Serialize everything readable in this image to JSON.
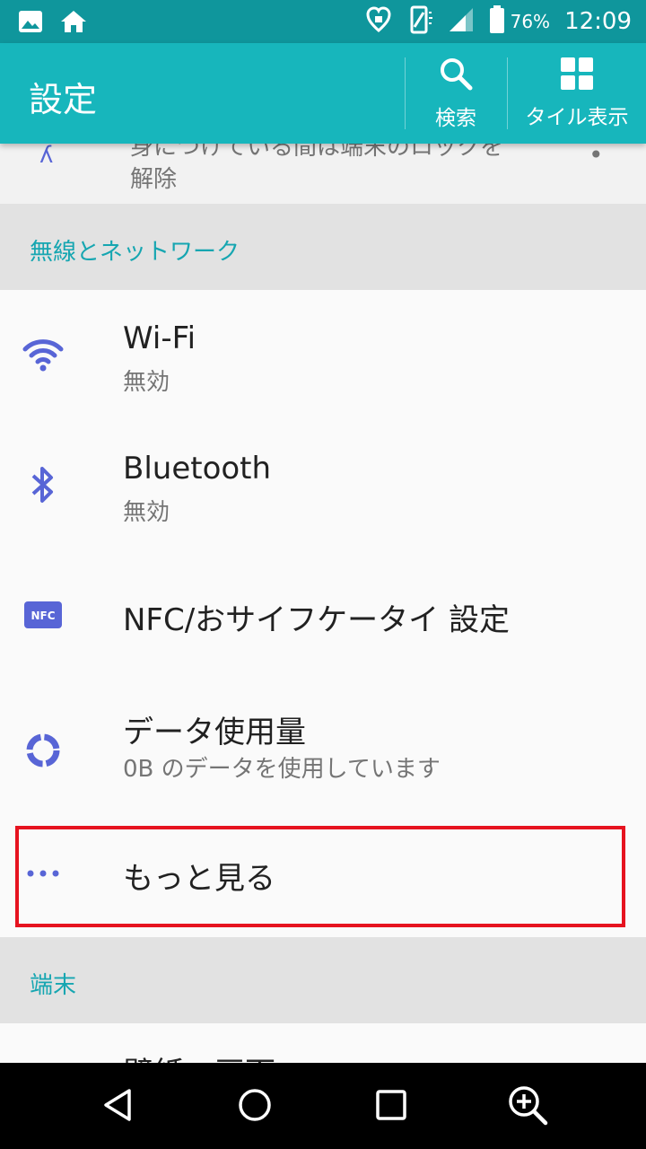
{
  "status_bar": {
    "battery_percent": "76%",
    "time": "12:09"
  },
  "toolbar": {
    "title": "設定",
    "search_label": "検索",
    "tile_label": "タイル表示"
  },
  "partial_item": {
    "text_line1": "身につけている間は端末のロックを",
    "text_line2": "解除"
  },
  "sections": {
    "wireless": "無線とネットワーク",
    "device": "端末"
  },
  "items": {
    "wifi": {
      "title": "Wi-Fi",
      "subtitle": "無効"
    },
    "bluetooth": {
      "title": "Bluetooth",
      "subtitle": "無効"
    },
    "nfc": {
      "title": "NFC/おサイフケータイ 設定",
      "icon_text": "NFC"
    },
    "data_usage": {
      "title": "データ使用量",
      "subtitle": "0B のデータを使用しています"
    },
    "more": {
      "title": "もっと見る"
    }
  },
  "partial_bottom": {
    "text": "壁紙・画面"
  },
  "colors": {
    "toolbar": "#17b6bc",
    "statusbar": "#0f969c",
    "accent_icon": "#5865d6",
    "section_text": "#16a6b1",
    "highlight": "#e6131f"
  }
}
